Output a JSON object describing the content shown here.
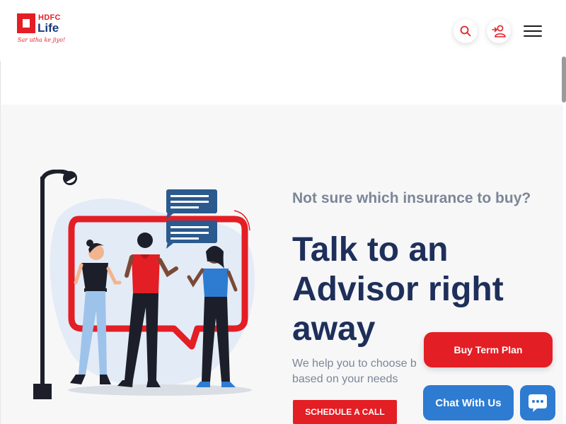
{
  "header": {
    "logo_top": "HDFC",
    "logo_bottom": "Life",
    "tagline": "Sar utha ke jiyo!",
    "icons": [
      "search-icon",
      "user-add-icon",
      "hamburger-menu-icon"
    ]
  },
  "hero": {
    "subheading": "Not sure which insurance to buy?",
    "headline": "Talk to an Advisor right away",
    "description": "We help you to choose b",
    "description_2": "based on your needs",
    "cta": "SCHEDULE A CALL"
  },
  "floating": {
    "buy_label": "Buy Term Plan",
    "chat_label": "Chat With Us"
  },
  "colors": {
    "brand_red": "#e31e24",
    "brand_navy": "#1e2f5a",
    "chat_blue": "#2e7bd2",
    "muted_text": "#7c8696"
  }
}
